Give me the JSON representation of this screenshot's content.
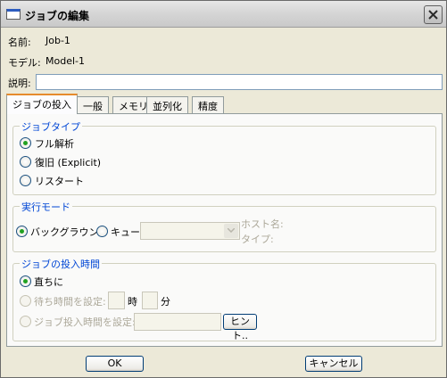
{
  "window": {
    "title": "ジョブの編集"
  },
  "fields": {
    "name_label": "名前:",
    "name_value": "Job-1",
    "model_label": "モデル:",
    "model_value": "Model-1",
    "description_label": "説明:",
    "description_value": ""
  },
  "tabs": [
    {
      "label": "ジョブの投入"
    },
    {
      "label": "一般"
    },
    {
      "label": "メモリ"
    },
    {
      "label": "並列化"
    },
    {
      "label": "精度"
    }
  ],
  "job_type": {
    "title": "ジョブタイプ",
    "options": [
      "フル解析",
      "復旧 (Explicit)",
      "リスタート"
    ],
    "selected": "フル解析"
  },
  "run_mode": {
    "title": "実行モード",
    "background_label": "バックグラウンド",
    "queue_label": "キュー:",
    "host_label": "ホスト名:",
    "type_label": "タイプ:",
    "selected": "バックグラウンド"
  },
  "submit_time": {
    "title": "ジョブの投入時間",
    "immediately_label": "直ちに",
    "wait_label": "待ち時間を設定:",
    "hours_label": "時",
    "minutes_label": "分",
    "at_label": "ジョブ投入時間を設定:",
    "hint_button": "ヒント..",
    "selected": "直ちに"
  },
  "buttons": {
    "ok": "OK",
    "cancel": "キャンセル"
  },
  "colors": {
    "group_title": "#0046d5",
    "radio_checked": "#21a121",
    "active_tab_accent": "#e68b2c"
  }
}
